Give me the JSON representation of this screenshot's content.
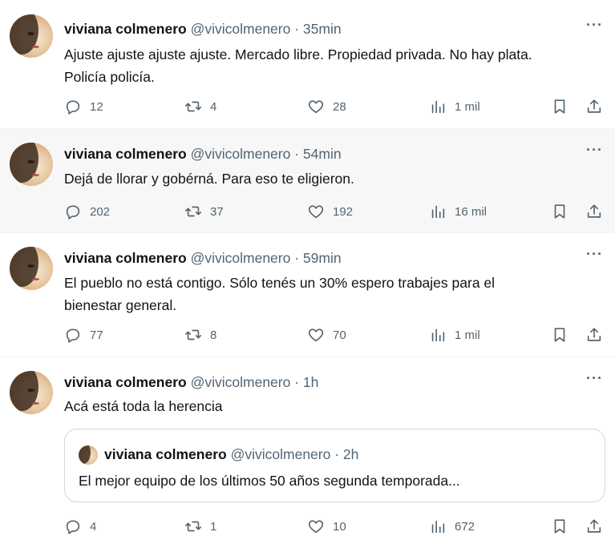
{
  "tweets": [
    {
      "name": "viviana colmenero",
      "handle": "@vivicolmenero",
      "time": "35min",
      "lines": [
        "Ajuste ajuste ajuste ajuste. Mercado libre. Propiedad privada. No hay plata.",
        "Policía policía."
      ],
      "replies": "12",
      "retweets": "4",
      "likes": "28",
      "views": "1 mil"
    },
    {
      "name": "viviana colmenero",
      "handle": "@vivicolmenero",
      "time": "54min",
      "lines": [
        "Dejá de llorar y gobérná. Para eso te eligieron."
      ],
      "replies": "202",
      "retweets": "37",
      "likes": "192",
      "views": "16 mil"
    },
    {
      "name": "viviana colmenero",
      "handle": "@vivicolmenero",
      "time": "59min",
      "lines": [
        "El pueblo no está contigo. Sólo tenés un 30% espero trabajes para el",
        "bienestar general."
      ],
      "replies": "77",
      "retweets": "8",
      "likes": "70",
      "views": "1 mil"
    },
    {
      "name": "viviana colmenero",
      "handle": "@vivicolmenero",
      "time": "1h",
      "lines": [
        "Acá está toda la herencia"
      ],
      "replies": "4",
      "retweets": "1",
      "likes": "10",
      "views": "672",
      "quote": {
        "name": "viviana colmenero",
        "handle": "@vivicolmenero",
        "time": "2h",
        "text": "El mejor equipo de los últimos 50 años segunda temporada..."
      }
    }
  ],
  "icons": {
    "more": "more-icon",
    "reply": "reply-icon",
    "retweet": "retweet-icon",
    "like": "heart-icon",
    "views": "views-icon",
    "bookmark": "bookmark-icon",
    "share": "share-icon"
  },
  "colors": {
    "text": "#0f1419",
    "secondary": "#536471",
    "divider": "#eff3f4",
    "hover_bg": "#f7f7f7"
  },
  "separator": "·"
}
